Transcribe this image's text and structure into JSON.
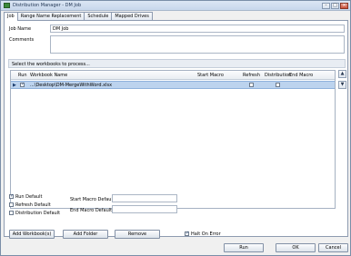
{
  "window": {
    "title": "Distribution Manager - DM Job"
  },
  "tabs": [
    {
      "label": "Job"
    },
    {
      "label": "Range Name Replacement"
    },
    {
      "label": "Schedule"
    },
    {
      "label": "Mapped Drives"
    }
  ],
  "job": {
    "name_label": "Job Name",
    "name_value": "DM Job",
    "comments_label": "Comments",
    "comments_value": ""
  },
  "workbooks": {
    "section_title": "Select the workbooks to process...",
    "columns": {
      "run": "Run",
      "name": "Workbook Name",
      "start_macro": "Start Macro",
      "refresh": "Refresh",
      "distribution": "Distribution",
      "end_macro": "End Macro"
    },
    "rows": [
      {
        "run": true,
        "name": "...\\Desktop\\DM-MergeWithWord.xlsx",
        "start_macro": "",
        "refresh": false,
        "distribution": false,
        "end_macro": ""
      }
    ]
  },
  "defaults": {
    "run_default": "Run Default",
    "refresh_default": "Refresh Default",
    "distribution_default": "Distribution Default",
    "start_macro_label": "Start Macro Default",
    "end_macro_label": "End Macro Default"
  },
  "buttons": {
    "add_workbooks": "Add Workbook(s)",
    "add_folder": "Add Folder",
    "remove": "Remove",
    "run": "Run",
    "ok": "OK",
    "cancel": "Cancel"
  },
  "halt_on_error": {
    "label": "Halt On Error",
    "checked": true
  }
}
